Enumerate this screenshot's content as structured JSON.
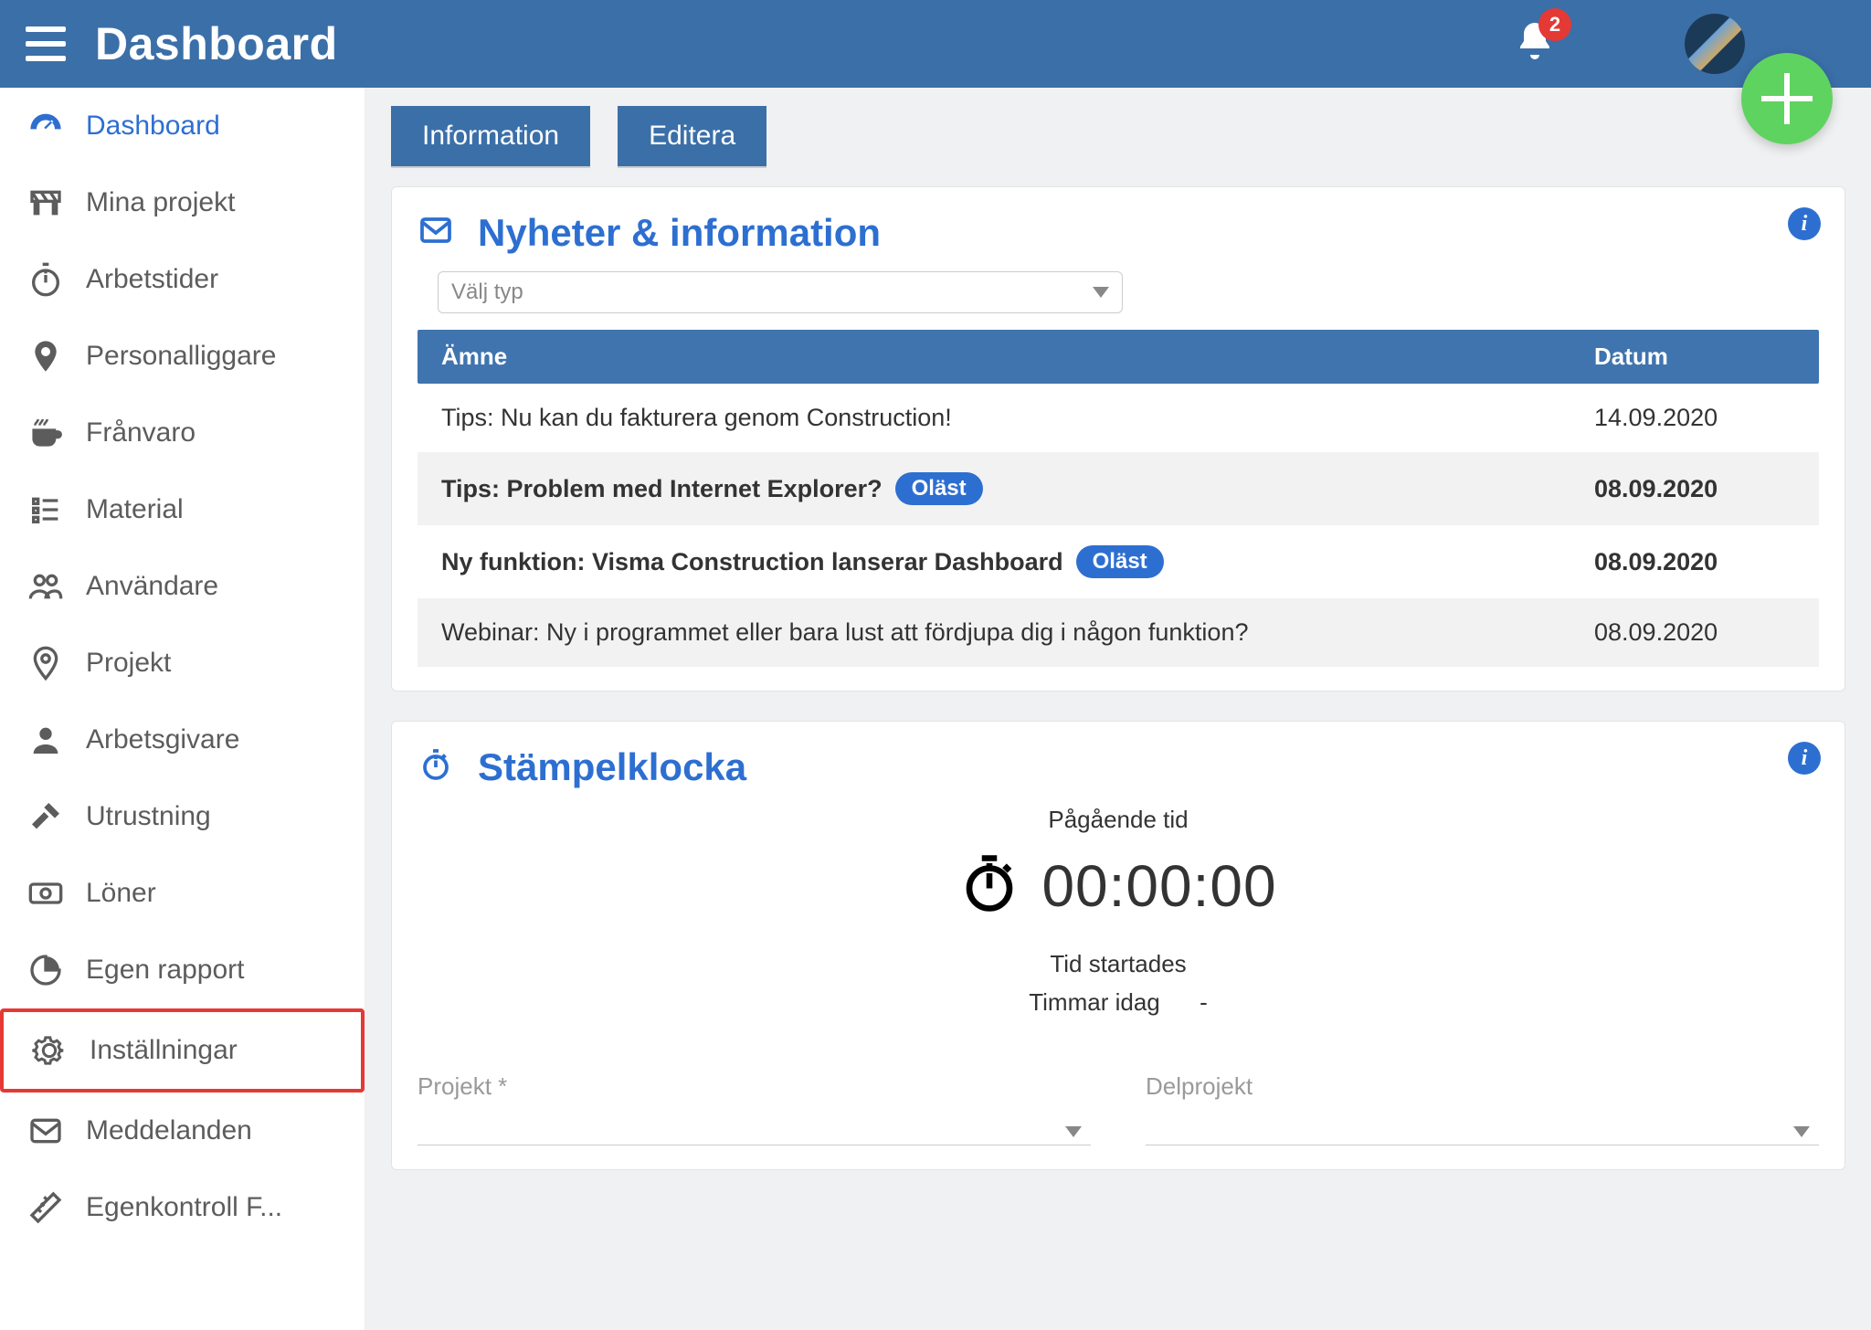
{
  "header": {
    "title": "Dashboard",
    "notification_count": "2"
  },
  "sidebar": {
    "items": [
      {
        "id": "dashboard",
        "label": "Dashboard",
        "active": true
      },
      {
        "id": "mina-projekt",
        "label": "Mina projekt"
      },
      {
        "id": "arbetstider",
        "label": "Arbetstider"
      },
      {
        "id": "personalliggare",
        "label": "Personalliggare"
      },
      {
        "id": "franvaro",
        "label": "Frånvaro"
      },
      {
        "id": "material",
        "label": "Material"
      },
      {
        "id": "anvandare",
        "label": "Användare"
      },
      {
        "id": "projekt",
        "label": "Projekt"
      },
      {
        "id": "arbetsgivare",
        "label": "Arbetsgivare"
      },
      {
        "id": "utrustning",
        "label": "Utrustning"
      },
      {
        "id": "loner",
        "label": "Löner"
      },
      {
        "id": "egen-rapport",
        "label": "Egen rapport"
      },
      {
        "id": "installningar",
        "label": "Inställningar",
        "highlight": true
      },
      {
        "id": "meddelanden",
        "label": "Meddelanden"
      },
      {
        "id": "egenkontroll",
        "label": "Egenkontroll F..."
      }
    ]
  },
  "tabs": {
    "information": "Information",
    "editera": "Editera"
  },
  "news": {
    "title": "Nyheter & information",
    "select_placeholder": "Välj typ",
    "header_subject": "Ämne",
    "header_date": "Datum",
    "unread_label": "Oläst",
    "rows": [
      {
        "subject": "Tips: Nu kan du fakturera genom Construction!",
        "date": "14.09.2020",
        "unread": false
      },
      {
        "subject": "Tips: Problem med Internet Explorer?",
        "date": "08.09.2020",
        "unread": true
      },
      {
        "subject": "Ny funktion: Visma Construction lanserar Dashboard",
        "date": "08.09.2020",
        "unread": true
      },
      {
        "subject": "Webinar: Ny i programmet eller bara lust att fördjupa dig i någon funktion?",
        "date": "08.09.2020",
        "unread": false
      }
    ]
  },
  "clock": {
    "title": "Stämpelklocka",
    "ongoing_label": "Pågående tid",
    "time": "00:00:00",
    "started_label": "Tid startades",
    "today_label": "Timmar idag",
    "today_value": "-",
    "project_label": "Projekt *",
    "subproject_label": "Delprojekt"
  }
}
